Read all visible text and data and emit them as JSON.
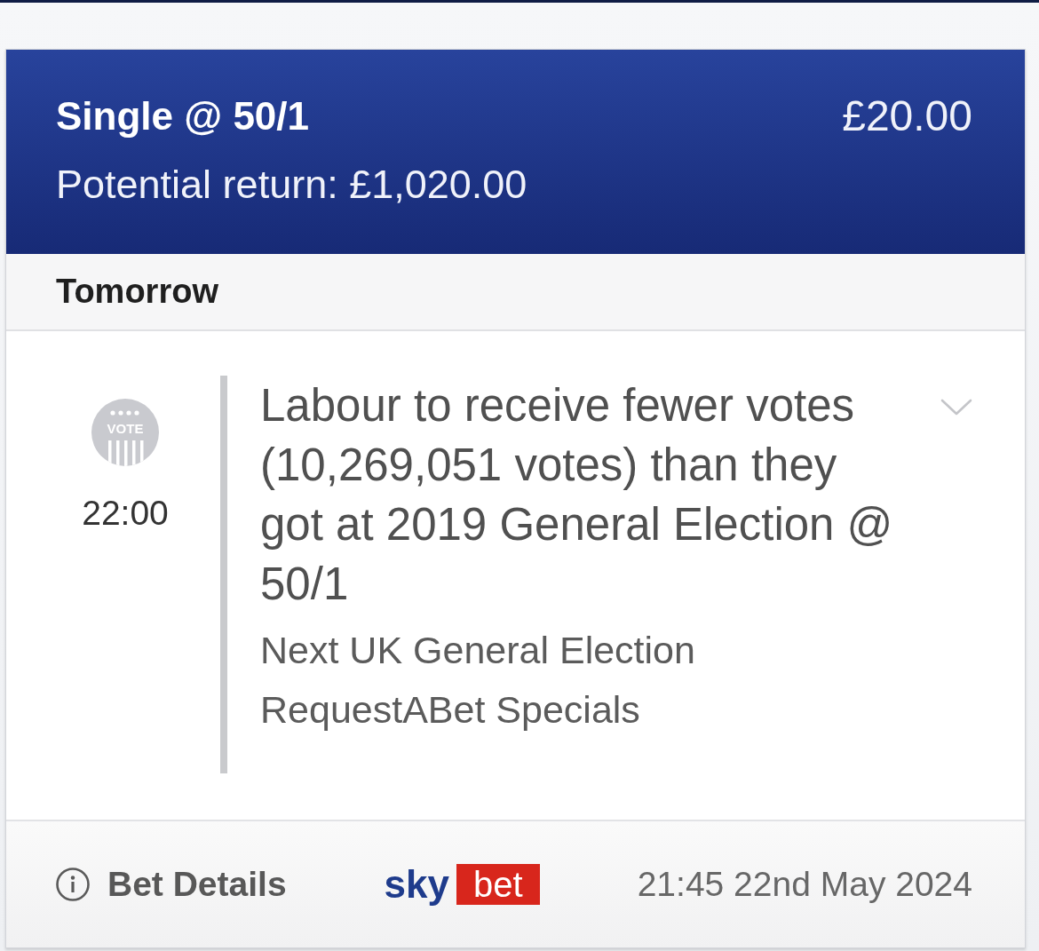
{
  "bet": {
    "title": "Single @ 50/1",
    "stake": "£20.00",
    "potential_return": "Potential return: £1,020.00"
  },
  "day_header": "Tomorrow",
  "selection": {
    "icon_text": "VOTE",
    "time": "22:00",
    "description": "Labour to receive fewer votes (10,269,051 votes) than they got at 2019 General Election @ 50/1",
    "event": "Next UK General Election",
    "market": "RequestABet Specials",
    "expanded": false
  },
  "footer": {
    "details_link": "Bet Details",
    "logo": {
      "word_1": "sky",
      "word_2": "bet"
    },
    "placed_at": "21:45 22nd May 2024"
  }
}
